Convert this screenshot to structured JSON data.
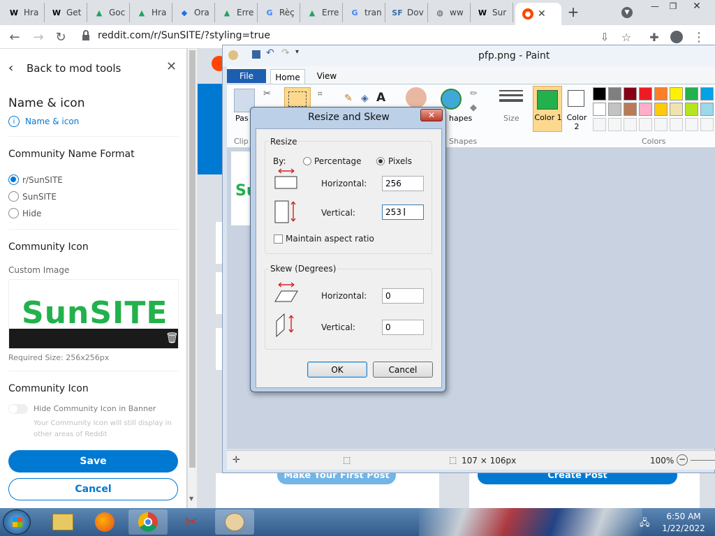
{
  "browser": {
    "tabs": [
      {
        "icon": "W",
        "label": "Hra"
      },
      {
        "icon": "W",
        "label": "Get"
      },
      {
        "icon": "▲",
        "label": "Goc"
      },
      {
        "icon": "▲",
        "label": "Hra"
      },
      {
        "icon": "◆",
        "label": "Ora"
      },
      {
        "icon": "▲",
        "label": "Erre"
      },
      {
        "icon": "G",
        "label": "Rèç"
      },
      {
        "icon": "▲",
        "label": "Erre"
      },
      {
        "icon": "G",
        "label": "tran"
      },
      {
        "icon": "SF",
        "label": "Dov"
      },
      {
        "icon": "◍",
        "label": "ww"
      },
      {
        "icon": "W",
        "label": "Sur"
      }
    ],
    "active_tab_icon": "reddit-icon",
    "url": "reddit.com/r/SunSITE/?styling=true"
  },
  "mod_panel": {
    "back_label": "Back to mod tools",
    "section_title": "Name & icon",
    "section_subtitle": "Name & icon",
    "name_format_heading": "Community Name Format",
    "name_options": [
      {
        "label": "r/SunSITE",
        "selected": true
      },
      {
        "label": "SunSITE",
        "selected": false
      },
      {
        "label": "Hide",
        "selected": false
      }
    ],
    "icon_heading": "Community Icon",
    "custom_image_label": "Custom Image",
    "preview_text": "SunSITE",
    "required_size": "Required Size: 256x256px",
    "icon_heading_2": "Community Icon",
    "hide_toggle_label": "Hide Community Icon in Banner",
    "hide_toggle_help": "Your Community Icon will still display in other areas of Reddit",
    "save_label": "Save",
    "cancel_label": "Cancel"
  },
  "paint": {
    "title": "pfp.png - Paint",
    "file_tab": "File",
    "home_tab": "Home",
    "view_tab": "View",
    "paste_label": "Pas",
    "clip_label": "Clip",
    "shapes_label": "hapes",
    "shapes_group": "Shapes",
    "size_label": "Size",
    "color1_label": "Color 1",
    "color2_label": "Color 2",
    "colors_group": "Colors",
    "canvas_text": "Su",
    "status_size": "107 × 106px",
    "zoom": "100%",
    "palette": [
      "#000000",
      "#7f7f7f",
      "#880015",
      "#ed1c24",
      "#ff7f27",
      "#fff200",
      "#22b14c",
      "#00a2e8",
      "#ffffff",
      "#c3c3c3",
      "#b97a57",
      "#ffaec9",
      "#ffc90e",
      "#efe4b0",
      "#b5e61d",
      "#99d9ea"
    ],
    "color1": "#22b14c",
    "color2": "#ffffff",
    "background_buttons": [
      "Make Your First Post",
      "Create Post"
    ]
  },
  "dialog": {
    "title": "Resize and Skew",
    "resize_group": "Resize",
    "by_label": "By:",
    "percentage_label": "Percentage",
    "pixels_label": "Pixels",
    "resize_horizontal_label": "Horizontal:",
    "resize_horizontal_value": "256",
    "resize_vertical_label": "Vertical:",
    "resize_vertical_value": "253",
    "maintain_label": "Maintain aspect ratio",
    "skew_group": "Skew (Degrees)",
    "skew_horizontal_label": "Horizontal:",
    "skew_horizontal_value": "0",
    "skew_vertical_label": "Vertical:",
    "skew_vertical_value": "0",
    "ok_label": "OK",
    "cancel_label": "Cancel"
  },
  "taskbar": {
    "time": "6:50 AM",
    "date": "1/22/2022"
  }
}
